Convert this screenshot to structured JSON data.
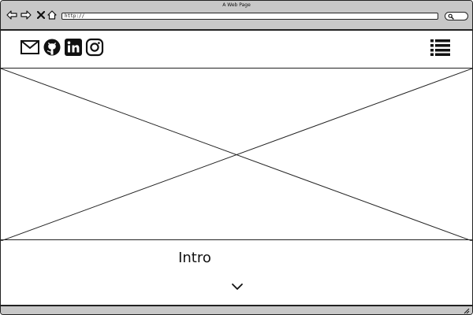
{
  "window": {
    "title": "A Web Page"
  },
  "toolbar": {
    "url": "http://",
    "buttons": {
      "back": "back-arrow-icon",
      "forward": "forward-arrow-icon",
      "stop": "close-icon",
      "home": "home-icon",
      "search": "search-icon"
    }
  },
  "header": {
    "social_icons": [
      "mail-icon",
      "github-icon",
      "linkedin-icon",
      "instagram-icon"
    ],
    "menu_icon": "list-menu-icon"
  },
  "hero": {
    "placeholder_icon": "image-placeholder-icon"
  },
  "intro": {
    "title": "Intro",
    "scroll_icon": "chevron-down-icon"
  },
  "colors": {
    "chrome": "#c8c8c8",
    "stroke": "#222222",
    "background": "#ffffff"
  }
}
